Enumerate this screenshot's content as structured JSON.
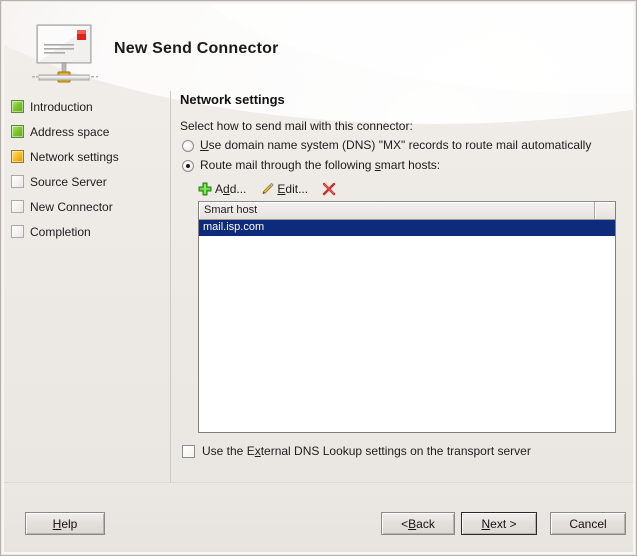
{
  "window": {
    "title": "New Send Connector",
    "icon": "send-connector-envelope-icon"
  },
  "sidebar": {
    "items": [
      {
        "label": "Introduction",
        "state": "done",
        "icon": "step-complete-icon"
      },
      {
        "label": "Address space",
        "state": "done",
        "icon": "step-complete-icon"
      },
      {
        "label": "Network settings",
        "state": "current",
        "icon": "step-current-icon"
      },
      {
        "label": "Source Server",
        "state": "todo",
        "icon": "step-pending-icon"
      },
      {
        "label": "New Connector",
        "state": "todo",
        "icon": "step-pending-icon"
      },
      {
        "label": "Completion",
        "state": "todo",
        "icon": "step-pending-icon"
      }
    ]
  },
  "content": {
    "heading": "Network settings",
    "instruction": "Select how to send mail with this connector:",
    "radios": [
      {
        "id": "dns-mx",
        "label_pre": "",
        "label_accel": "U",
        "label_post": "se domain name system (DNS) \"MX\" records to route mail automatically",
        "checked": false
      },
      {
        "id": "smart-hosts",
        "label_pre": "Route mail through the following ",
        "label_accel": "s",
        "label_post": "mart hosts:",
        "checked": true
      }
    ],
    "toolbar": [
      {
        "label_pre": "A",
        "label_accel": "d",
        "label_post": "d...",
        "icon": "add-plus-icon",
        "name": "add-button"
      },
      {
        "label_pre": "",
        "label_accel": "E",
        "label_post": "dit...",
        "icon": "edit-pencil-icon",
        "name": "edit-button"
      },
      {
        "label_pre": "",
        "label_accel": "",
        "label_post": "",
        "icon": "delete-x-icon",
        "name": "delete-button"
      }
    ],
    "listview": {
      "columns": [
        "Smart host",
        ""
      ],
      "rows": [
        {
          "cells": [
            "mail.isp.com"
          ],
          "selected": true
        }
      ]
    },
    "checkbox": {
      "checked": false,
      "label_pre": "Use the E",
      "label_accel": "x",
      "label_post": "ternal DNS Lookup settings on the transport server"
    }
  },
  "footer": {
    "help": {
      "pre": "",
      "accel": "H",
      "post": "elp"
    },
    "back": {
      "pre": "< ",
      "accel": "B",
      "post": "ack"
    },
    "next": {
      "pre": "",
      "accel": "N",
      "post": "ext >",
      "default": true
    },
    "cancel": {
      "pre": "Cancel",
      "accel": "",
      "post": ""
    }
  },
  "colors": {
    "selection_blue": "#0e2a7a",
    "step_done_green": "#7ec62e",
    "step_current_gold": "#f6bf20",
    "add_icon_green": "#3cb424",
    "delete_icon_red": "#c8302a",
    "edit_icon_gold": "#e8b646"
  }
}
